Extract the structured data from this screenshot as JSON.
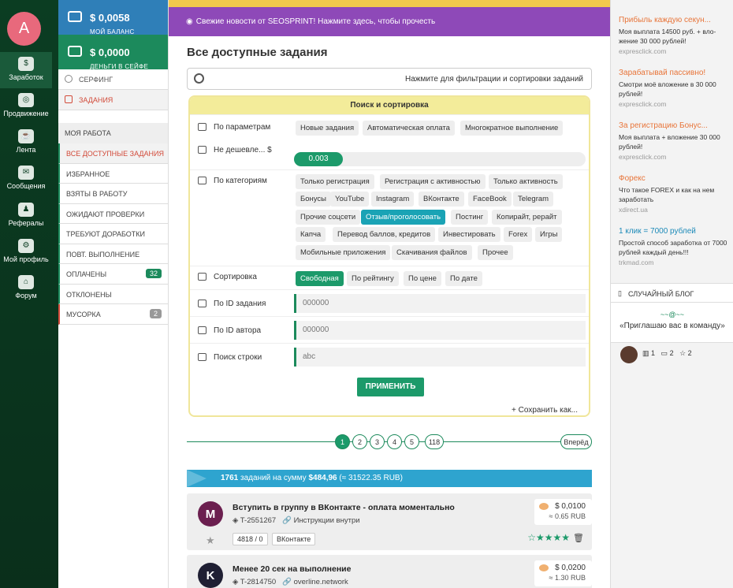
{
  "nav": {
    "avatar_letter": "A",
    "items": [
      {
        "label": "Заработок",
        "icon": "money-bag-icon"
      },
      {
        "label": "Продвижение",
        "icon": "target-icon"
      },
      {
        "label": "Лента",
        "icon": "coffee-icon"
      },
      {
        "label": "Сообщения",
        "icon": "chat-icon"
      },
      {
        "label": "Рефералы",
        "icon": "users-icon"
      },
      {
        "label": "Мой профиль",
        "icon": "gear-icon"
      },
      {
        "label": "Форум",
        "icon": "bank-icon"
      }
    ]
  },
  "sidebar": {
    "balance_amount": "$ 0,0058",
    "balance_label": "МОЙ БАЛАНС",
    "safe_amount": "$ 0,0000",
    "safe_label": "ДЕНЬГИ В СЕЙФЕ",
    "menu": [
      {
        "label": "СЕРФИНГ"
      },
      {
        "label": "ЗАДАНИЯ"
      }
    ],
    "section_label": "МОЯ РАБОТА",
    "work_items": [
      {
        "label": "ВСЕ ДОСТУПНЫЕ ЗАДАНИЯ"
      },
      {
        "label": "ИЗБРАННОЕ"
      },
      {
        "label": "ВЗЯТЫ В РАБОТУ"
      },
      {
        "label": "ОЖИДАЮТ ПРОВЕРКИ"
      },
      {
        "label": "ТРЕБУЮТ ДОРАБОТКИ"
      },
      {
        "label": "ПОВТ. ВЫПОЛНЕНИЕ"
      },
      {
        "label": "ОПЛАЧЕНЫ",
        "badge": "32"
      },
      {
        "label": "ОТКЛОНЕНЫ"
      },
      {
        "label": "МУСОРКА",
        "badge": "2"
      }
    ]
  },
  "main": {
    "news": "Свежие новости от SEOSPRINT! Нажмите здесь, чтобы прочесть",
    "title": "Все доступные задания",
    "filter_hint": "Нажмите для фильтрации и сортировки заданий",
    "panel": {
      "header": "Поиск и сортировка",
      "params_label": "По параметрам",
      "params": [
        "Новые задания",
        "Автоматическая оплата",
        "Многократное выполнение"
      ],
      "price_label": "Не дешевле... $",
      "price_value": "0.003",
      "price_fill_fraction": 0.17,
      "categories_label": "По категориям",
      "categories": [
        "Только регистрация",
        "Регистрация с активностью",
        "Только активность",
        "Бонусы",
        "YouTube",
        "Instagram",
        "ВКонтакте",
        "FaceBook",
        "Telegram",
        "Прочие соцсети",
        "Отзыв/проголосовать",
        "Постинг",
        "Копирайт, рерайт",
        "Капча",
        "Перевод баллов, кредитов",
        "Инвестировать",
        "Forex",
        "Игры",
        "Мобильные приложения",
        "Скачивания файлов",
        "Прочее"
      ],
      "selected_category": "Отзыв/проголосовать",
      "sort_label": "Сортировка",
      "sort": [
        "Свободная",
        "По рейтингу",
        "По цене",
        "По дате"
      ],
      "selected_sort": "Свободная",
      "task_id_label": "По ID задания",
      "task_id_placeholder": "000000",
      "author_id_label": "По ID автора",
      "author_id_placeholder": "000000",
      "search_label": "Поиск строки",
      "search_placeholder": "abc",
      "apply": "ПРИМЕНИТЬ",
      "save": "Сохранить как..."
    },
    "pages": [
      "1",
      "2",
      "3",
      "4",
      "5",
      "118"
    ],
    "next": "Вперёд",
    "stats": {
      "count": "1761",
      "text1": "заданий на сумму",
      "sum": "$484,96",
      "rub": "(≈ 31522.35 RUB)"
    },
    "tasks": [
      {
        "letter": "M",
        "title": "Вступить в группу в ВКонтакте - оплата моментально",
        "id": "T-2551267",
        "link": "Инструкции внутри",
        "price": "$ 0,0100",
        "rub": "≈ 0.65 RUB",
        "counts": "4818 / 0",
        "category": "ВКонтакте",
        "rating_stars": 5,
        "avatar_color": "#6b1f4f"
      },
      {
        "letter": "K",
        "title": "Менее 20 сек на выполнение",
        "id": "T-2814750",
        "link": "overline.network",
        "price": "$ 0,0200",
        "rub": "≈ 1.30 RUB",
        "avatar_color": "#1f1f33"
      }
    ]
  },
  "right": {
    "ads": [
      {
        "title": "Прибыль каждую секун...",
        "desc": "Моя выплата 14500 руб. + вло-жение 30 000 рублей!",
        "url": "expresclick.com"
      },
      {
        "title": "Зарабатывай пассивно!",
        "desc": "Смотри моё вложение в 30 000 рублей!",
        "url": "expresclick.com"
      },
      {
        "title": "За регистрацию Бонус...",
        "desc": "Моя выплата + вложение 30 000 рублей!",
        "url": "expresclick.com"
      },
      {
        "title": "Форекс",
        "desc": "Что такое FOREX и как на нем заработать",
        "url": "xdirect.ua"
      },
      {
        "title": "1 клик = 7000 рублей",
        "desc": "Простой способ заработка от 7000 рублей каждый день!!!",
        "url": "trkmad.com"
      }
    ],
    "blog_header": "СЛУЧАЙНЫЙ БЛОГ",
    "blog_ornament": "~~@~~",
    "blog_title": "«Приглашаю вас в команду»",
    "blog_stats": {
      "books": "1",
      "comments": "2",
      "stars": "2"
    }
  },
  "colors": {
    "brand_green": "#1c8a5c",
    "accent_purple": "#8e49b8",
    "accent_blue": "#2ea4cf",
    "accent_orange": "#e8753a"
  }
}
